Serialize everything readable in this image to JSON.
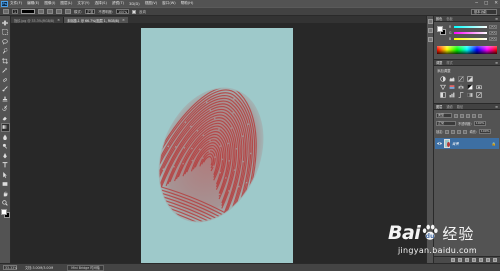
{
  "app": {
    "logo": "Ps"
  },
  "menu": [
    "文件(F)",
    "编辑(E)",
    "图像(I)",
    "图层(L)",
    "文字(Y)",
    "选择(S)",
    "滤镜(T)",
    "3D(D)",
    "视图(V)",
    "窗口(W)",
    "帮助(H)"
  ],
  "window_controls": [
    "─",
    "□",
    "✕"
  ],
  "options_bar": {
    "size_value": "1",
    "mode_label": "模式:",
    "mode_value": "正常",
    "opacity_label": "不透明度:",
    "opacity_value": "100%",
    "reverse_label": "反向",
    "workspace": "基本功能"
  },
  "tabs": [
    {
      "title": "指纹.jpg @ 33.3%(RGB/8)",
      "active": false
    },
    {
      "title": "未标题-1 @ 66.7%(图层 1, RGB/8)",
      "active": true
    }
  ],
  "status": {
    "zoom": "33.33%",
    "doc": "文档:3.00M/3.00M",
    "tab": "Mini Bridge  时间轴"
  },
  "colors": {
    "foreground": "#ffffff",
    "background": "#000000",
    "canvas_bg": "#9ec9ca",
    "ink": "#b53a3a",
    "selected_layer": "#3d6fa3"
  },
  "color_panel": {
    "tabs": [
      "颜色",
      "色板"
    ],
    "sliders": [
      {
        "label": "R",
        "value": "255"
      },
      {
        "label": "G",
        "value": "255"
      },
      {
        "label": "B",
        "value": "255"
      }
    ]
  },
  "adjustments_panel": {
    "tabs": [
      "调整",
      "样式"
    ],
    "title": "添加调整"
  },
  "layers_panel": {
    "tabs": [
      "图层",
      "通道",
      "路径"
    ],
    "kind_filter": "类型",
    "blend_mode": "正常",
    "opacity_label": "不透明度:",
    "opacity_value": "100%",
    "lock_label": "锁定:",
    "fill_label": "填充:",
    "fill_value": "100%",
    "layer_name": "背景"
  },
  "watermark": {
    "brand_left": "Bai",
    "brand_right": "经验",
    "url": "jingyan.baidu.com"
  }
}
